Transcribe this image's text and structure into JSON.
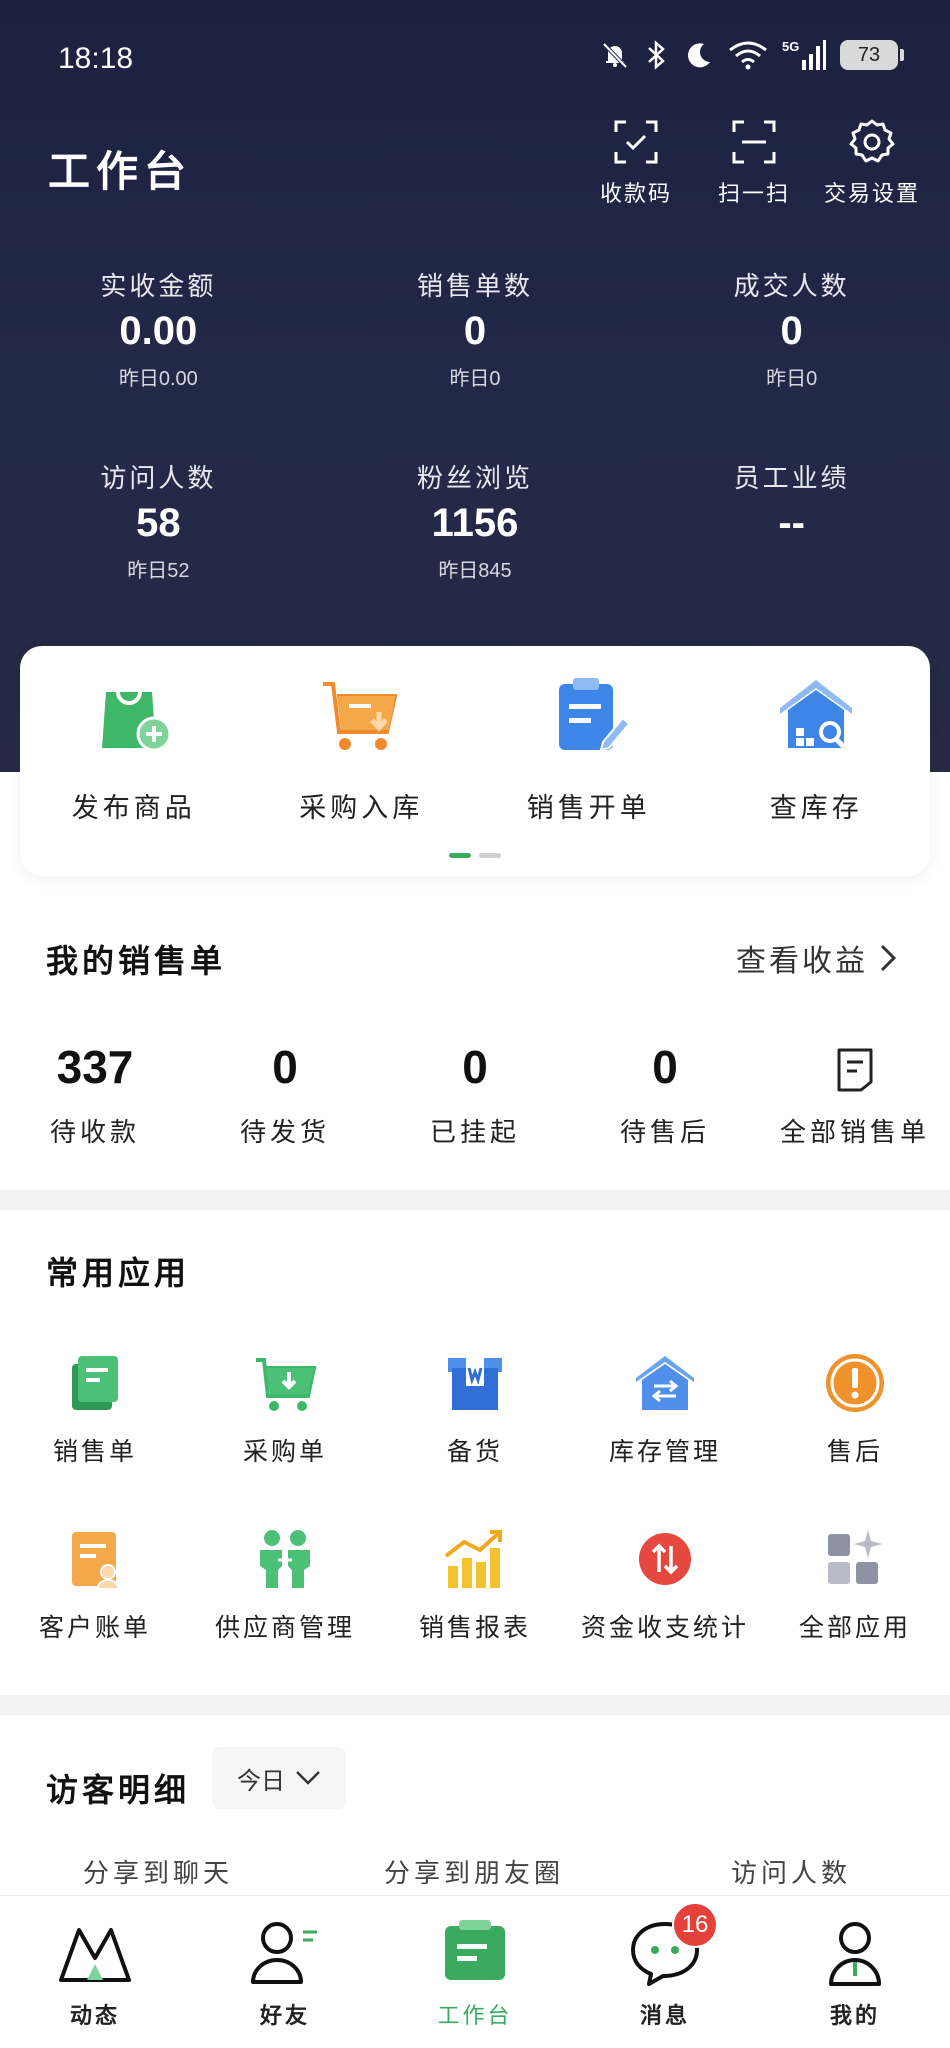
{
  "status": {
    "time": "18:18",
    "battery": "73",
    "network": "5G"
  },
  "header": {
    "title": "工作台",
    "actions": [
      {
        "label": "收款码",
        "icon": "receive-qr-icon"
      },
      {
        "label": "扫一扫",
        "icon": "scan-icon"
      },
      {
        "label": "交易设置",
        "icon": "gear-icon"
      }
    ]
  },
  "stats": [
    {
      "label": "实收金额",
      "value": "0.00",
      "sub": "昨日0.00"
    },
    {
      "label": "销售单数",
      "value": "0",
      "sub": "昨日0"
    },
    {
      "label": "成交人数",
      "value": "0",
      "sub": "昨日0"
    },
    {
      "label": "访问人数",
      "value": "58",
      "sub": "昨日52"
    },
    {
      "label": "粉丝浏览",
      "value": "1156",
      "sub": "昨日845"
    },
    {
      "label": "员工业绩",
      "value": "--",
      "sub": ""
    }
  ],
  "quick": [
    {
      "label": "发布商品",
      "icon": "publish-bag-icon"
    },
    {
      "label": "采购入库",
      "icon": "cart-in-icon"
    },
    {
      "label": "销售开单",
      "icon": "clipboard-icon"
    },
    {
      "label": "查库存",
      "icon": "warehouse-search-icon"
    }
  ],
  "sales": {
    "title": "我的销售单",
    "link": "查看收益",
    "items": [
      {
        "value": "337",
        "label": "待收款"
      },
      {
        "value": "0",
        "label": "待发货"
      },
      {
        "value": "0",
        "label": "已挂起"
      },
      {
        "value": "0",
        "label": "待售后"
      },
      {
        "value": "",
        "label": "全部销售单"
      }
    ]
  },
  "apps": {
    "title": "常用应用",
    "items": [
      {
        "label": "销售单",
        "icon": "sales-order-icon"
      },
      {
        "label": "采购单",
        "icon": "purchase-cart-icon"
      },
      {
        "label": "备货",
        "icon": "stock-box-icon"
      },
      {
        "label": "库存管理",
        "icon": "inventory-house-icon"
      },
      {
        "label": "售后",
        "icon": "after-sales-icon"
      },
      {
        "label": "客户账单",
        "icon": "customer-bill-icon"
      },
      {
        "label": "供应商管理",
        "icon": "supplier-icon"
      },
      {
        "label": "销售报表",
        "icon": "sales-report-icon"
      },
      {
        "label": "资金收支统计",
        "icon": "cash-flow-icon"
      },
      {
        "label": "全部应用",
        "icon": "all-apps-icon"
      }
    ]
  },
  "visitors": {
    "title": "访客明细",
    "range": "今日",
    "columns": [
      "分享到聊天",
      "分享到朋友圈",
      "访问人数"
    ]
  },
  "tabs": [
    {
      "label": "动态",
      "icon": "moments-icon"
    },
    {
      "label": "好友",
      "icon": "friends-icon"
    },
    {
      "label": "工作台",
      "icon": "workbench-icon",
      "active": true
    },
    {
      "label": "消息",
      "icon": "message-icon",
      "badge": "16"
    },
    {
      "label": "我的",
      "icon": "profile-icon"
    }
  ],
  "colors": {
    "accent": "#3aaa5e",
    "hero": "#1f2442",
    "badge": "#e5413b"
  }
}
